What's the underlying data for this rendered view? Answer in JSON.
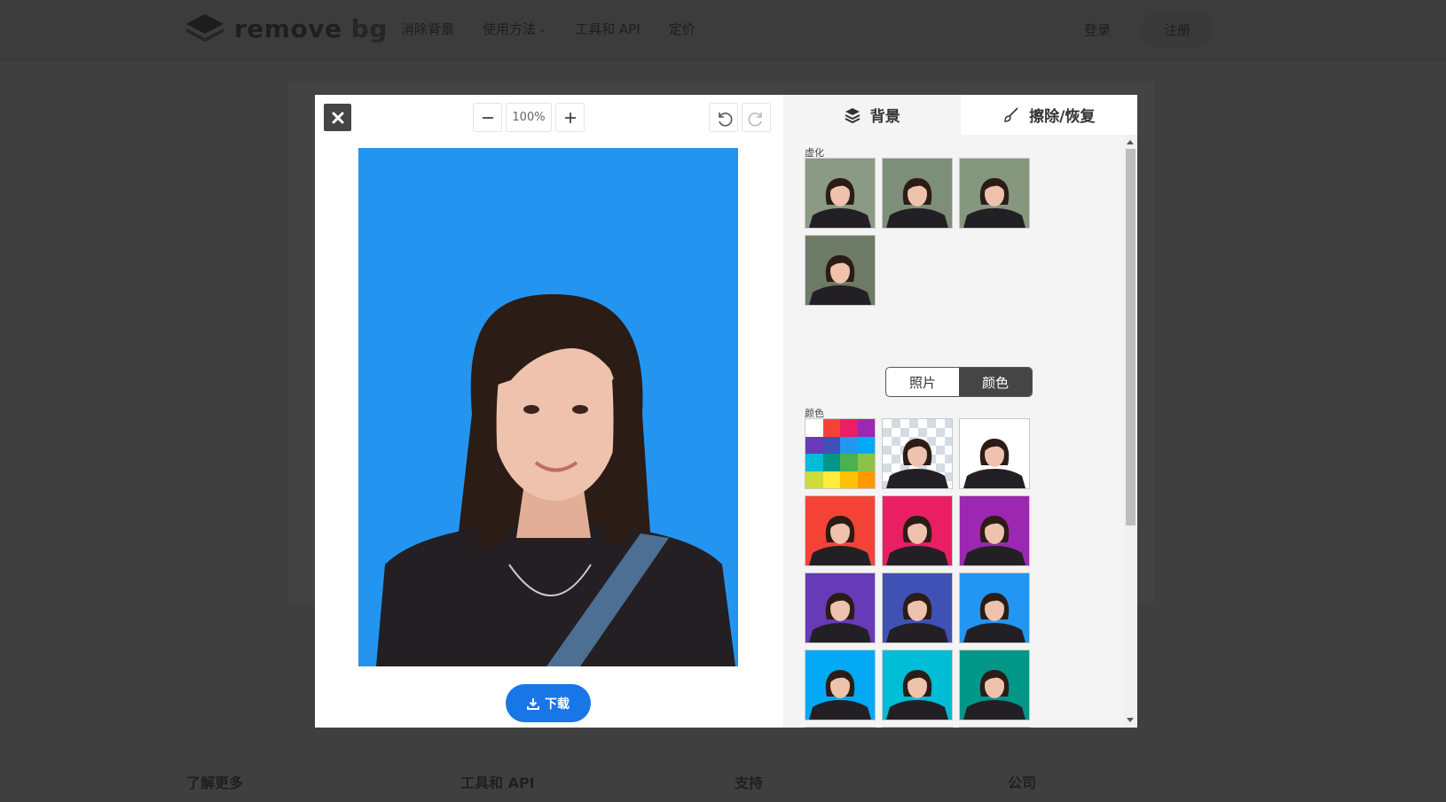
{
  "nav": {
    "brand": "remove",
    "brand_suffix": "bg",
    "links": [
      "消除背景",
      "使用方法",
      "工具和 API",
      "定价"
    ],
    "login": "登录",
    "signup": "注册"
  },
  "footer": {
    "cols": [
      "了解更多",
      "工具和 API",
      "支持",
      "公司"
    ]
  },
  "editor": {
    "zoom_value": "100%",
    "download_label": "下载",
    "photo_bg_color": "#2395f0"
  },
  "side": {
    "tabs": [
      {
        "label": "背景",
        "icon": "layers-icon",
        "active": true
      },
      {
        "label": "擦除/恢复",
        "icon": "brush-icon",
        "active": false
      }
    ],
    "blur_label": "虚化",
    "segment": {
      "options": [
        "照片",
        "颜色"
      ],
      "selected": "颜色"
    },
    "color_label": "颜色",
    "blur_thumbs": [
      "#8a9a84",
      "#7d8f78",
      "#86977f",
      "#6d7b66"
    ],
    "color_thumbs": [
      "palette",
      "transparent",
      "#ffffff",
      "#f44336",
      "#e91e63",
      "#9c27b0",
      "#673ab7",
      "#3f51b5",
      "#2196f3",
      "#03a9f4",
      "#00bcd4",
      "#009688",
      "#4caf50",
      "#8bc34a",
      "#cddc39"
    ],
    "palette_colors": [
      "#ffffff",
      "#f44336",
      "#e91e63",
      "#9c27b0",
      "#673ab7",
      "#3f51b5",
      "#2196f3",
      "#03a9f4",
      "#00bcd4",
      "#009688",
      "#4caf50",
      "#8bc34a",
      "#cddc39",
      "#ffeb3b",
      "#ffc107",
      "#ff9800"
    ]
  }
}
